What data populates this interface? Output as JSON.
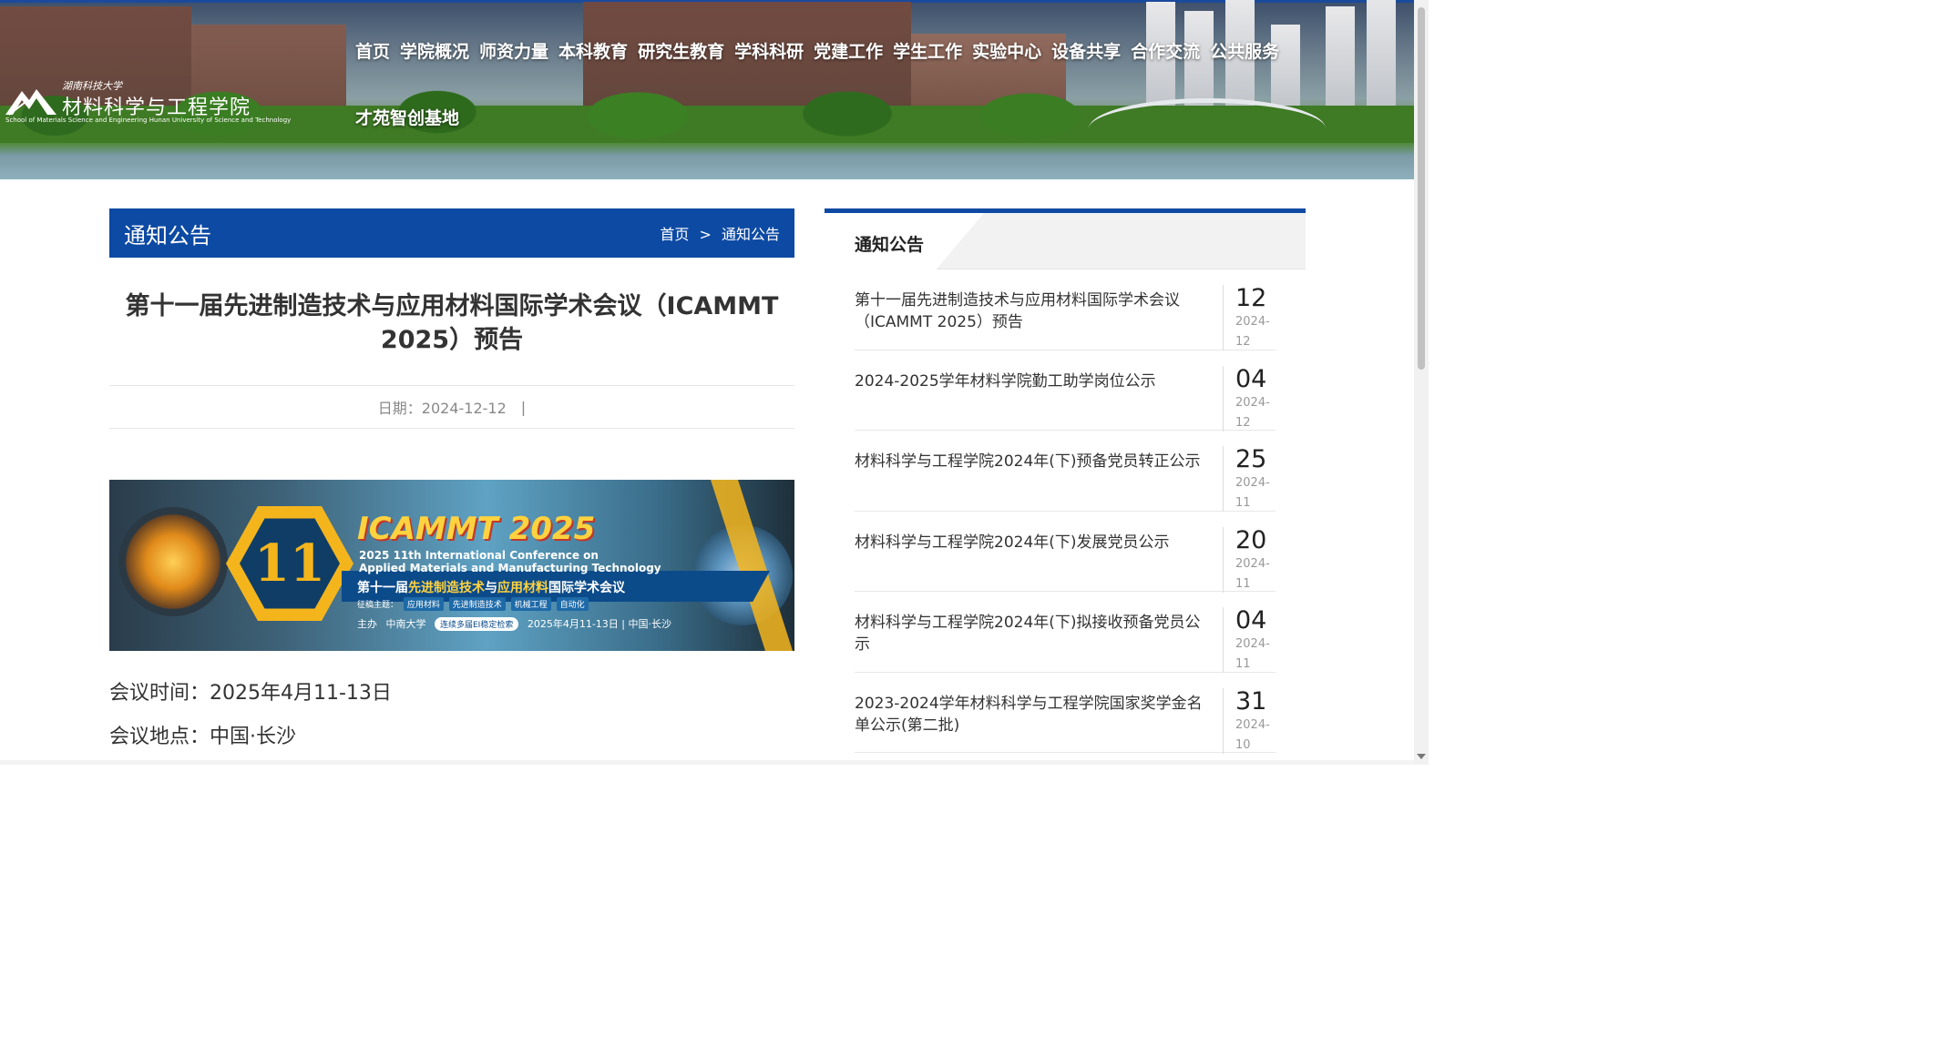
{
  "header": {
    "logo": {
      "university": "湖南科技大学",
      "college_cn": "材料科学与工程学院",
      "college_en": "School of Materials Science and Engineering Hunan University of Science and Technology"
    },
    "nav": [
      {
        "label": "首页"
      },
      {
        "label": "学院概况"
      },
      {
        "label": "师资力量"
      },
      {
        "label": "本科教育"
      },
      {
        "label": "研究生教育"
      },
      {
        "label": "学科科研"
      },
      {
        "label": "党建工作"
      },
      {
        "label": "学生工作"
      },
      {
        "label": "实验中心"
      },
      {
        "label": "设备共享"
      },
      {
        "label": "合作交流"
      },
      {
        "label": "公共服务"
      },
      {
        "label": "才苑智创基地"
      }
    ]
  },
  "breadcrumb_bar": {
    "title": "通知公告",
    "home": "首页",
    "separator": ">",
    "current": "通知公告"
  },
  "article": {
    "title": "第十一届先进制造技术与应用材料国际学术会议（ICAMMT 2025）预告",
    "date_label": "日期：2024-12-12",
    "divider": "|",
    "banner": {
      "title": "ICAMMT 2025",
      "number": "11",
      "en_line1": "2025 11th International Conference on",
      "en_line2": "Applied Materials and Manufacturing Technology",
      "cn_prefix": "第十一届",
      "cn_highlight1": "先进制造技术",
      "cn_mid": "与",
      "cn_highlight2": "应用材料",
      "cn_suffix": "国际学术会议",
      "topics_label": "征稿主题：",
      "topics": [
        "应用材料",
        "先进制造技术",
        "机械工程",
        "自动化"
      ],
      "host_label": "主办",
      "host": "中南大学",
      "ei_note": "连续多届EI稳定检索",
      "date_place": "2025年4月11-13日 | 中国·长沙"
    },
    "time_label": "会议时间：",
    "time_value": "2025年4月11-13日",
    "place_label": "会议地点：",
    "place_value": "中国·长沙"
  },
  "sidebar": {
    "title": "通知公告",
    "items": [
      {
        "text": "第十一届先进制造技术与应用材料国际学术会议（ICAMMT 2025）预告",
        "day": "12",
        "ym": "2024-12"
      },
      {
        "text": "2024-2025学年材料学院勤工助学岗位公示",
        "day": "04",
        "ym": "2024-12"
      },
      {
        "text": "材料科学与工程学院2024年(下)预备党员转正公示",
        "day": "25",
        "ym": "2024-11"
      },
      {
        "text": "材料科学与工程学院2024年(下)发展党员公示",
        "day": "20",
        "ym": "2024-11"
      },
      {
        "text": "材料科学与工程学院2024年(下)拟接收预备党员公示",
        "day": "04",
        "ym": "2024-11"
      },
      {
        "text": "2023-2024学年材料科学与工程学院国家奖学金名单公示(第二批)",
        "day": "31",
        "ym": "2024-10"
      }
    ]
  }
}
